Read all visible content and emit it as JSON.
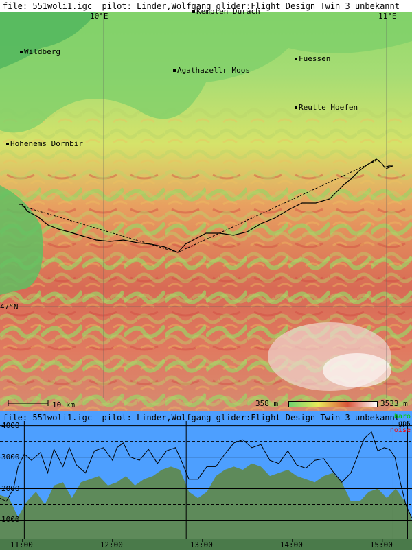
{
  "map": {
    "header": "file: 551woli1.igc  pilot: Linder,Wolfgang glider:Flight Design Twin 3 unbekannt",
    "lon_labels": [
      "10°E",
      "11°E"
    ],
    "lat_label": "47°N",
    "towns": [
      {
        "name": "Kempten Durach"
      },
      {
        "name": "Wildberg"
      },
      {
        "name": "Fuessen"
      },
      {
        "name": "Agathazellr Moos"
      },
      {
        "name": "Reutte Hoefen"
      },
      {
        "name": "Hohenems Dornbir"
      }
    ],
    "scale_label": "10 km",
    "elev_min_label": "358 m",
    "elev_max_label": "3533 m",
    "elev_gradient": [
      "#6fd36f",
      "#e9e95a",
      "#d9533a",
      "#ffffff"
    ]
  },
  "profile": {
    "header": "file: 551woli1.igc  pilot: Linder,Wolfgang glider:Flight Design Twin 3 unbekannt",
    "legend": [
      {
        "label": "baro",
        "color": "#00cc00"
      },
      {
        "label": "gps",
        "color": "#000000"
      },
      {
        "label": "noise",
        "color": "#ff0000"
      }
    ],
    "y_ticks": [
      "4000",
      "3000",
      "2000",
      "1000"
    ],
    "x_ticks": [
      "11:00",
      "12:00",
      "13:00",
      "14:00",
      "15:00"
    ],
    "colors": {
      "sky": "#4d9fff",
      "ground": "#5e8a5a",
      "track": "#000000"
    }
  },
  "chart_data": {
    "type": "area",
    "title": "file: 551woli1.igc  pilot: Linder,Wolfgang glider:Flight Design Twin 3 unbekannt",
    "xlabel": "",
    "ylabel": "",
    "x_ticks": [
      "11:00",
      "12:00",
      "13:00",
      "14:00",
      "15:00"
    ],
    "y_ticks": [
      1000,
      2000,
      3000,
      4000
    ],
    "ylim": [
      400,
      4450
    ],
    "x_range_hours": [
      10.75,
      15.33
    ],
    "series": [
      {
        "name": "gps",
        "x": [
          10.75,
          10.82,
          10.9,
          10.95,
          11.02,
          11.1,
          11.2,
          11.28,
          11.35,
          11.45,
          11.52,
          11.6,
          11.7,
          11.8,
          11.9,
          12.0,
          12.05,
          12.12,
          12.2,
          12.3,
          12.4,
          12.5,
          12.6,
          12.7,
          12.78,
          12.85,
          12.95,
          13.05,
          13.15,
          13.25,
          13.35,
          13.45,
          13.55,
          13.65,
          13.75,
          13.85,
          13.95,
          14.05,
          14.15,
          14.25,
          14.35,
          14.45,
          14.55,
          14.65,
          14.72,
          14.8,
          14.88,
          14.95,
          15.02,
          15.08,
          15.14,
          15.2,
          15.26,
          15.33
        ],
        "y": [
          1700,
          1600,
          2000,
          2700,
          3100,
          2900,
          3150,
          2500,
          3250,
          2700,
          3300,
          2750,
          2500,
          3200,
          3300,
          2900,
          3300,
          3450,
          3000,
          2900,
          3250,
          2800,
          3200,
          3300,
          2800,
          2300,
          2300,
          2700,
          2700,
          3100,
          3450,
          3550,
          3300,
          3400,
          2900,
          2800,
          3200,
          2750,
          2650,
          2900,
          2950,
          2550,
          2200,
          2500,
          3000,
          3600,
          3800,
          3200,
          3300,
          3250,
          3000,
          2200,
          1500,
          1050
        ]
      },
      {
        "name": "ground",
        "x": [
          10.75,
          10.85,
          10.95,
          11.05,
          11.15,
          11.25,
          11.35,
          11.45,
          11.55,
          11.65,
          11.75,
          11.85,
          11.95,
          12.05,
          12.15,
          12.25,
          12.35,
          12.45,
          12.55,
          12.65,
          12.75,
          12.85,
          12.95,
          13.05,
          13.15,
          13.25,
          13.35,
          13.45,
          13.55,
          13.65,
          13.75,
          13.85,
          13.95,
          14.05,
          14.15,
          14.25,
          14.35,
          14.45,
          14.55,
          14.65,
          14.75,
          14.85,
          14.95,
          15.05,
          15.15,
          15.25,
          15.33
        ],
        "y": [
          1800,
          1700,
          1100,
          1600,
          1900,
          1500,
          2100,
          2200,
          1700,
          2200,
          2300,
          2400,
          2100,
          2200,
          2400,
          2100,
          2300,
          2400,
          2600,
          2700,
          2600,
          1900,
          1700,
          1900,
          2400,
          2600,
          2700,
          2600,
          2800,
          2700,
          2400,
          2500,
          2600,
          2400,
          2300,
          2200,
          2400,
          2500,
          2200,
          1600,
          1600,
          1900,
          2000,
          1700,
          2000,
          1600,
          1000
        ]
      }
    ]
  }
}
